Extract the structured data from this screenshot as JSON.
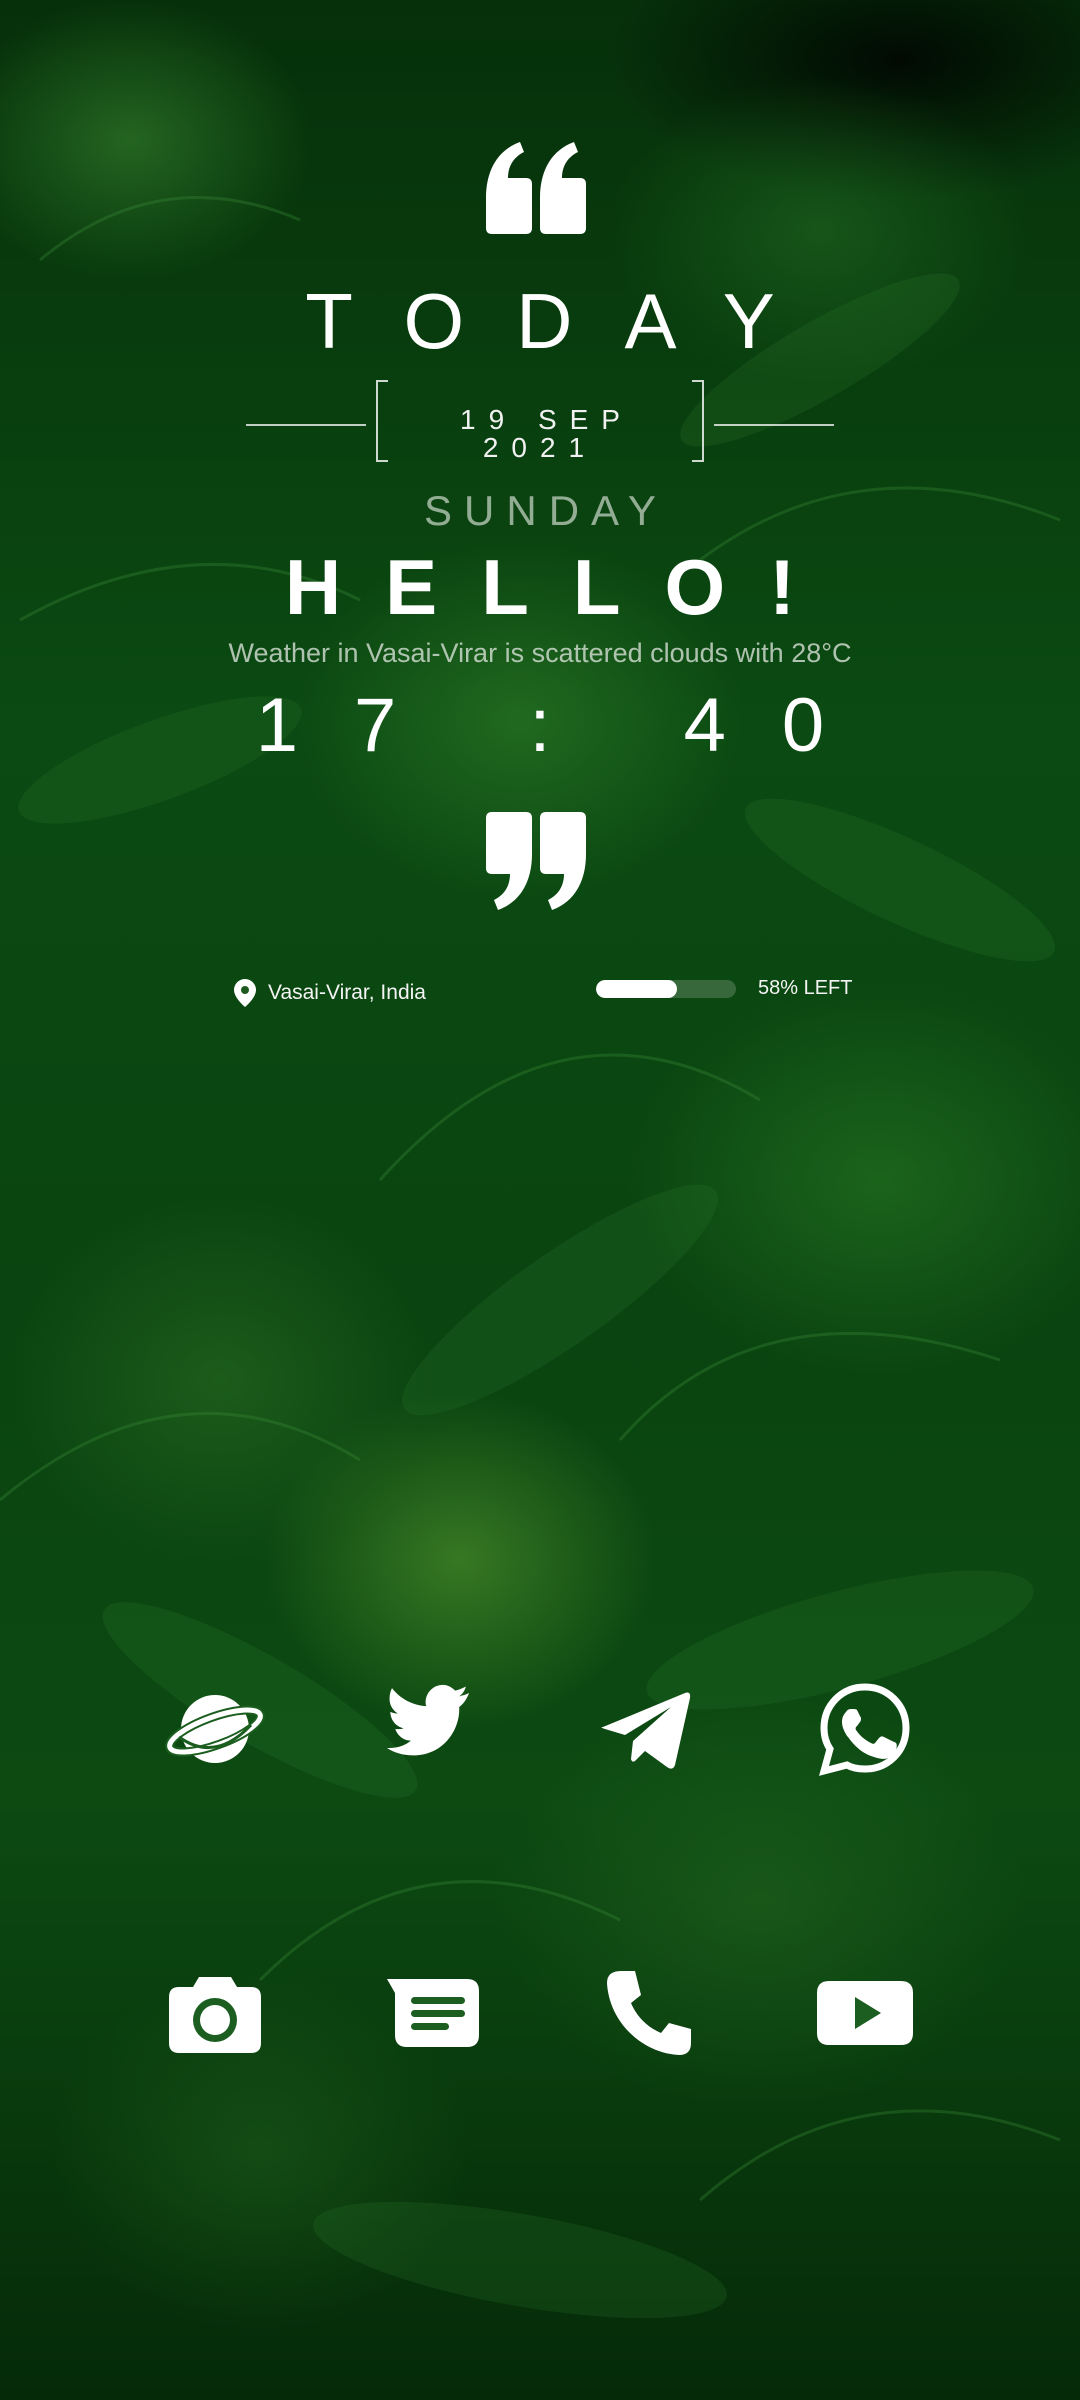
{
  "header": {
    "title": "TODAY",
    "date": "19 SEP 2021",
    "weekday": "SUNDAY",
    "greeting": "HELLO!",
    "weather": "Weather in Vasai-Virar is scattered clouds with 28°C",
    "time": "17 : 40"
  },
  "status": {
    "location": "Vasai-Virar, India",
    "battery_percent": 58,
    "battery_label": "58% LEFT"
  },
  "apps": {
    "row1": [
      {
        "icon": "planet-browser-icon"
      },
      {
        "icon": "twitter-icon"
      },
      {
        "icon": "telegram-icon"
      },
      {
        "icon": "whatsapp-icon"
      }
    ],
    "row2": [
      {
        "icon": "camera-icon"
      },
      {
        "icon": "messages-icon"
      },
      {
        "icon": "phone-icon"
      },
      {
        "icon": "youtube-icon"
      }
    ]
  },
  "colors": {
    "foreground": "#ffffff",
    "wallpaper_green": "#0b4a12"
  }
}
